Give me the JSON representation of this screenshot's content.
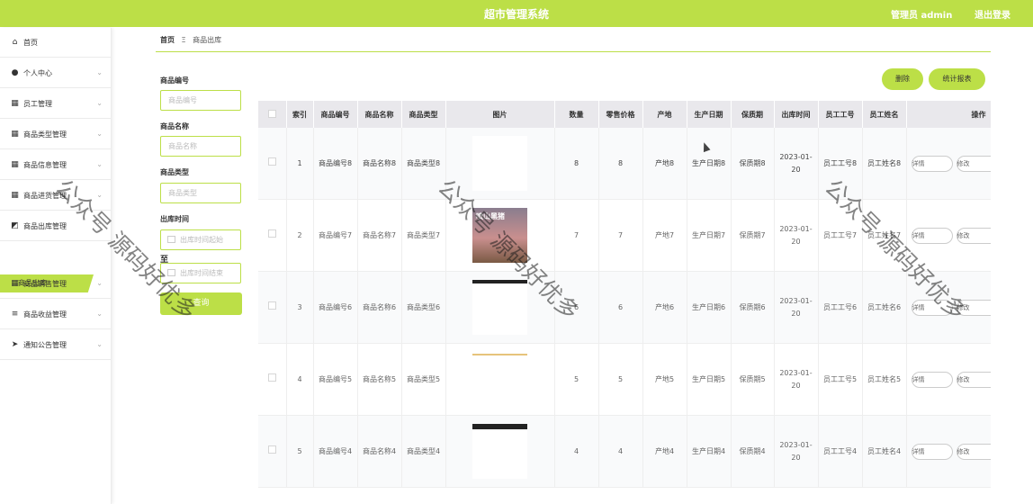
{
  "header": {
    "title": "超市管理系统",
    "admin": "管理员 admin",
    "logout": "退出登录"
  },
  "sidebar": {
    "items": [
      {
        "label": "首页",
        "icon": "home-icon"
      },
      {
        "label": "个人中心",
        "icon": "user-icon"
      },
      {
        "label": "员工管理",
        "icon": "grid-icon"
      },
      {
        "label": "商品类型管理",
        "icon": "grid-icon"
      },
      {
        "label": "商品信息管理",
        "icon": "grid-icon"
      },
      {
        "label": "商品进货管理",
        "icon": "grid-icon"
      },
      {
        "label": "商品出库管理",
        "icon": "chart-icon"
      },
      {
        "label": "商品销售管理",
        "icon": "grid-icon"
      },
      {
        "label": "商品收益管理",
        "icon": "list-icon"
      },
      {
        "label": "通知公告管理",
        "icon": "send-icon"
      }
    ],
    "active_sub": "商品出库"
  },
  "breadcrumb": {
    "home": "首页",
    "separator": "Ξ",
    "current": "商品出库"
  },
  "search": {
    "code_label": "商品编号",
    "code_placeholder": "商品编号",
    "name_label": "商品名称",
    "name_placeholder": "商品名称",
    "type_label": "商品类型",
    "type_placeholder": "商品类型",
    "time_label": "出库时间",
    "start_placeholder": "出库时间起始",
    "to_label": "至",
    "end_placeholder": "出库时间结束",
    "query_button": "查询"
  },
  "toolbar": {
    "delete": "删除",
    "report": "统计报表"
  },
  "table": {
    "columns": [
      "",
      "索引",
      "商品编号",
      "商品名称",
      "商品类型",
      "图片",
      "数量",
      "零售价格",
      "产地",
      "生产日期",
      "保质期",
      "出库时间",
      "员工工号",
      "员工姓名",
      "操作"
    ],
    "rows": [
      {
        "index": "1",
        "code": "商品编号8",
        "name": "商品名称8",
        "type": "商品类型8",
        "qty": "8",
        "price": "8",
        "origin": "产地8",
        "prod_date": "生产日期8",
        "shelf": "保质期8",
        "out_time": "2023-01-20",
        "emp_no": "员工工号8",
        "emp_name": "员工姓名8"
      },
      {
        "index": "2",
        "code": "商品编号7",
        "name": "商品名称7",
        "type": "商品类型7",
        "qty": "7",
        "price": "7",
        "origin": "产地7",
        "prod_date": "生产日期7",
        "shelf": "保质期7",
        "out_time": "2023-01-20",
        "emp_no": "员工工号7",
        "emp_name": "员工姓名7"
      },
      {
        "index": "3",
        "code": "商品编号6",
        "name": "商品名称6",
        "type": "商品类型6",
        "qty": "6",
        "price": "6",
        "origin": "产地6",
        "prod_date": "生产日期6",
        "shelf": "保质期6",
        "out_time": "2023-01-20",
        "emp_no": "员工工号6",
        "emp_name": "员工姓名6"
      },
      {
        "index": "4",
        "code": "商品编号5",
        "name": "商品名称5",
        "type": "商品类型5",
        "qty": "5",
        "price": "5",
        "origin": "产地5",
        "prod_date": "生产日期5",
        "shelf": "保质期5",
        "out_time": "2023-01-20",
        "emp_no": "员工工号5",
        "emp_name": "员工姓名5"
      },
      {
        "index": "5",
        "code": "商品编号4",
        "name": "商品名称4",
        "type": "商品类型4",
        "qty": "4",
        "price": "4",
        "origin": "产地4",
        "prod_date": "生产日期4",
        "shelf": "保质期4",
        "out_time": "2023-01-20",
        "emp_no": "员工工号4",
        "emp_name": "员工姓名4"
      }
    ],
    "detail_button": "详情",
    "edit_button": "修改",
    "image_caption": "喷山黑猪"
  },
  "watermark": "公众号 源码好优多"
}
